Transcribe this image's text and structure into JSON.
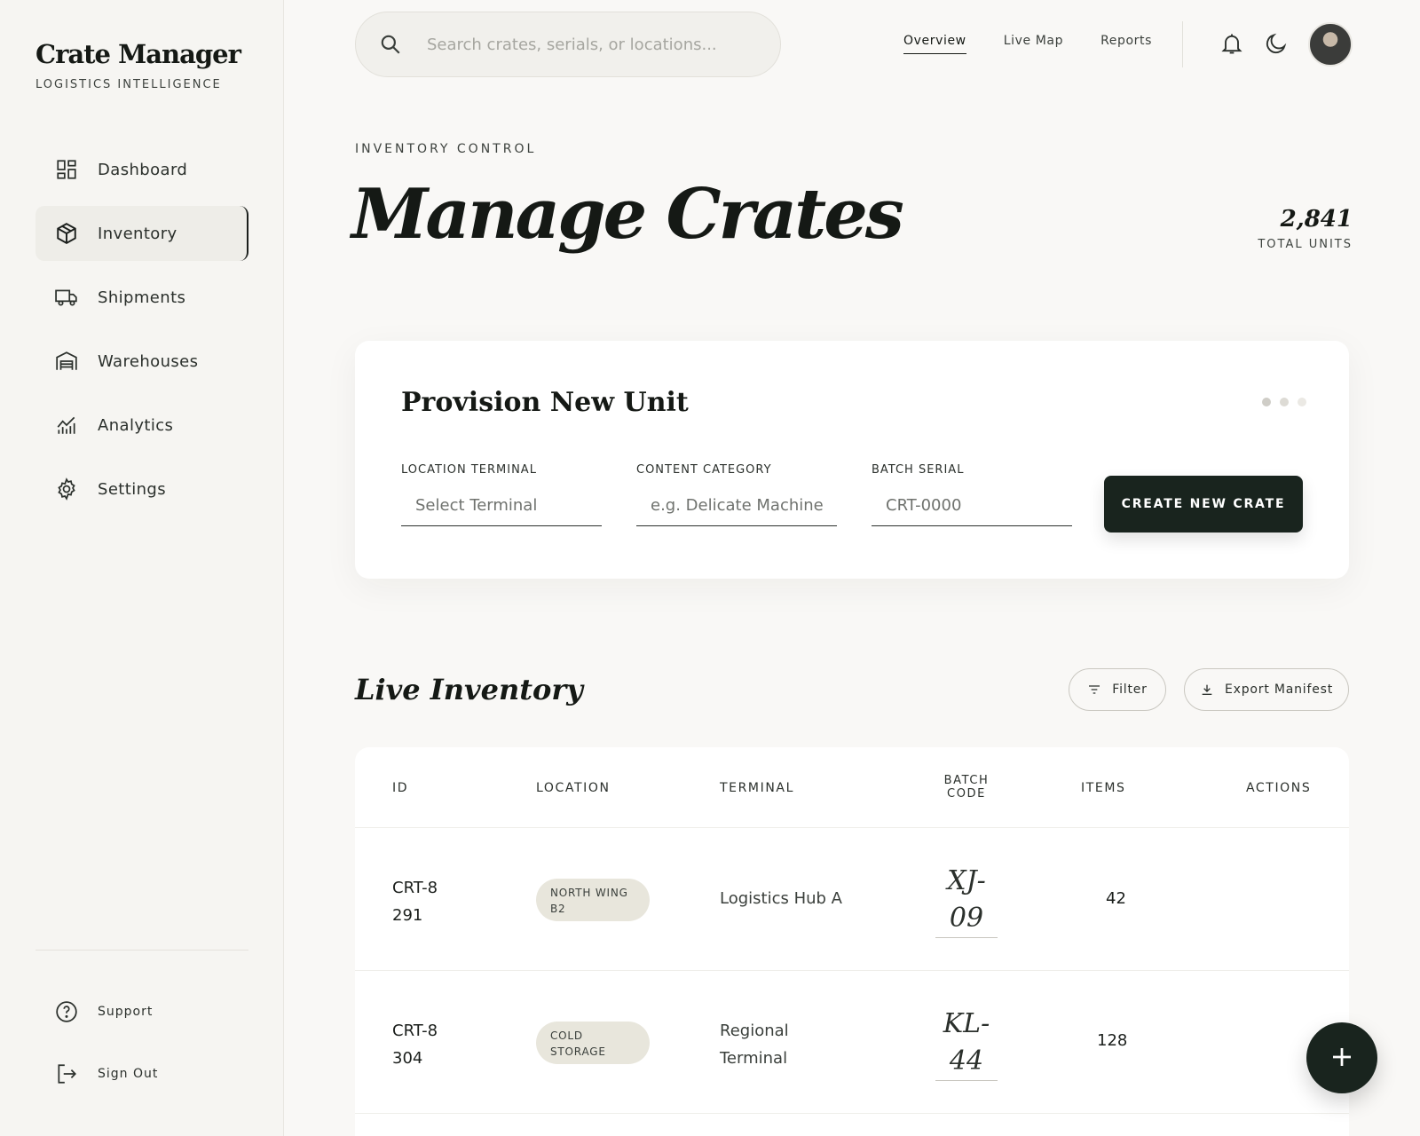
{
  "brand": {
    "title": "Crate Manager",
    "subtitle": "LOGISTICS INTELLIGENCE"
  },
  "sidebar": {
    "items": [
      {
        "label": "Dashboard",
        "icon": "dashboard-icon"
      },
      {
        "label": "Inventory",
        "icon": "box-icon",
        "active": true
      },
      {
        "label": "Shipments",
        "icon": "truck-icon"
      },
      {
        "label": "Warehouses",
        "icon": "warehouse-icon"
      },
      {
        "label": "Analytics",
        "icon": "analytics-icon"
      },
      {
        "label": "Settings",
        "icon": "gear-icon"
      }
    ],
    "footer": [
      {
        "label": "Support",
        "icon": "help-icon"
      },
      {
        "label": "Sign Out",
        "icon": "logout-icon"
      }
    ]
  },
  "search": {
    "placeholder": "Search crates, serials, or locations..."
  },
  "topnav": {
    "items": [
      "Overview",
      "Live Map",
      "Reports"
    ],
    "active": "Overview"
  },
  "header": {
    "eyebrow": "INVENTORY CONTROL",
    "title": "Manage Crates",
    "total_value": "2,841",
    "total_label": "TOTAL UNITS"
  },
  "provision": {
    "title": "Provision New Unit",
    "fields": [
      {
        "label": "LOCATION TERMINAL",
        "placeholder": "Select Terminal"
      },
      {
        "label": "CONTENT CATEGORY",
        "placeholder": "e.g. Delicate Machinery"
      },
      {
        "label": "BATCH SERIAL",
        "placeholder": "CRT-0000"
      }
    ],
    "button": "CREATE NEW CRATE"
  },
  "inventory": {
    "title": "Live Inventory",
    "filter_label": "Filter",
    "export_label": "Export Manifest",
    "columns": [
      "ID",
      "LOCATION",
      "TERMINAL",
      "BATCH CODE",
      "ITEMS",
      "ACTIONS"
    ],
    "rows": [
      {
        "id": "CRT-8291",
        "location": "NORTH WING B2",
        "terminal": "Logistics Hub A",
        "batch": "XJ-09",
        "items": "42"
      },
      {
        "id": "CRT-8304",
        "location": "COLD STORAGE",
        "terminal": "Regional Terminal",
        "batch": "KL-44",
        "items": "128"
      }
    ]
  },
  "colors": {
    "accent": "#19241e",
    "background": "#f9f8f6",
    "badge": "#e8e6dc"
  }
}
